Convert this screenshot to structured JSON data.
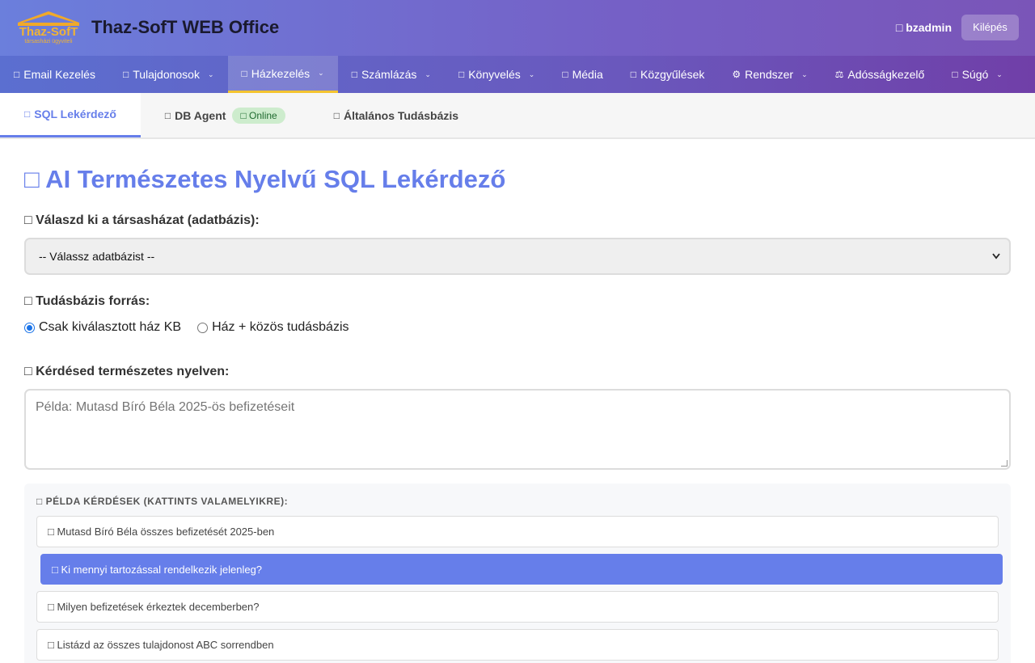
{
  "header": {
    "logo_text": "Thaz-SofT",
    "logo_subtext": "társasházi ügyviteli",
    "app_title": "Thaz-SofT WEB Office",
    "user_icon": "□",
    "username": "bzadmin",
    "logout_label": "Kilépés"
  },
  "nav": {
    "items": [
      {
        "icon": "□",
        "label": "Email Kezelés",
        "dropdown": false
      },
      {
        "icon": "□",
        "label": "Tulajdonosok",
        "dropdown": true
      },
      {
        "icon": "□",
        "label": "Házkezelés",
        "dropdown": true,
        "active": true
      },
      {
        "icon": "□",
        "label": "Számlázás",
        "dropdown": true
      },
      {
        "icon": "□",
        "label": "Könyvelés",
        "dropdown": true
      },
      {
        "icon": "□",
        "label": "Média",
        "dropdown": false
      },
      {
        "icon": "□",
        "label": "Közgyűlések",
        "dropdown": false
      },
      {
        "icon": "⚙",
        "label": "Rendszer",
        "dropdown": true
      },
      {
        "icon": "⚖",
        "label": "Adósságkezelő",
        "dropdown": false
      },
      {
        "icon": "□",
        "label": "Súgó",
        "dropdown": true
      }
    ],
    "chevron": "⌄"
  },
  "tabs": [
    {
      "icon": "□",
      "label": "SQL Lekérdező",
      "active": true
    },
    {
      "icon": "□",
      "label": "DB Agent",
      "badge": "□ Online"
    },
    {
      "icon": "□",
      "label": "Általános Tudásbázis"
    }
  ],
  "main": {
    "title": "□ AI Természetes Nyelvű SQL Lekérdező",
    "db_label": "□ Válaszd ki a társasházat (adatbázis):",
    "db_select_value": "-- Válassz adatbázist --",
    "kb_label": "□ Tudásbázis forrás:",
    "kb_options": [
      "Csak kiválasztott ház KB",
      "Ház + közös tudásbázis"
    ],
    "kb_selected_index": 0,
    "question_label": "□ Kérdésed természetes nyelven:",
    "question_placeholder": "Példa: Mutasd Bíró Béla 2025-ös befizetéseit",
    "examples_header": "□ PÉLDA KÉRDÉSEK (KATTINTS VALAMELYIKRE):",
    "examples": [
      "□ Mutasd Bíró Béla összes befizetését 2025-ben",
      "□ Ki mennyi tartozással rendelkezik jelenleg?",
      "□ Milyen befizetések érkeztek decemberben?",
      "□ Listázd az összes tulajdonost ABC sorrendben"
    ],
    "highlighted_example_index": 1
  },
  "colors": {
    "accent": "#667eea",
    "header_start": "#6b7fdc",
    "header_end": "#7a55b8",
    "active_underline": "#f4c430",
    "online_badge_bg": "#cdeccd"
  }
}
